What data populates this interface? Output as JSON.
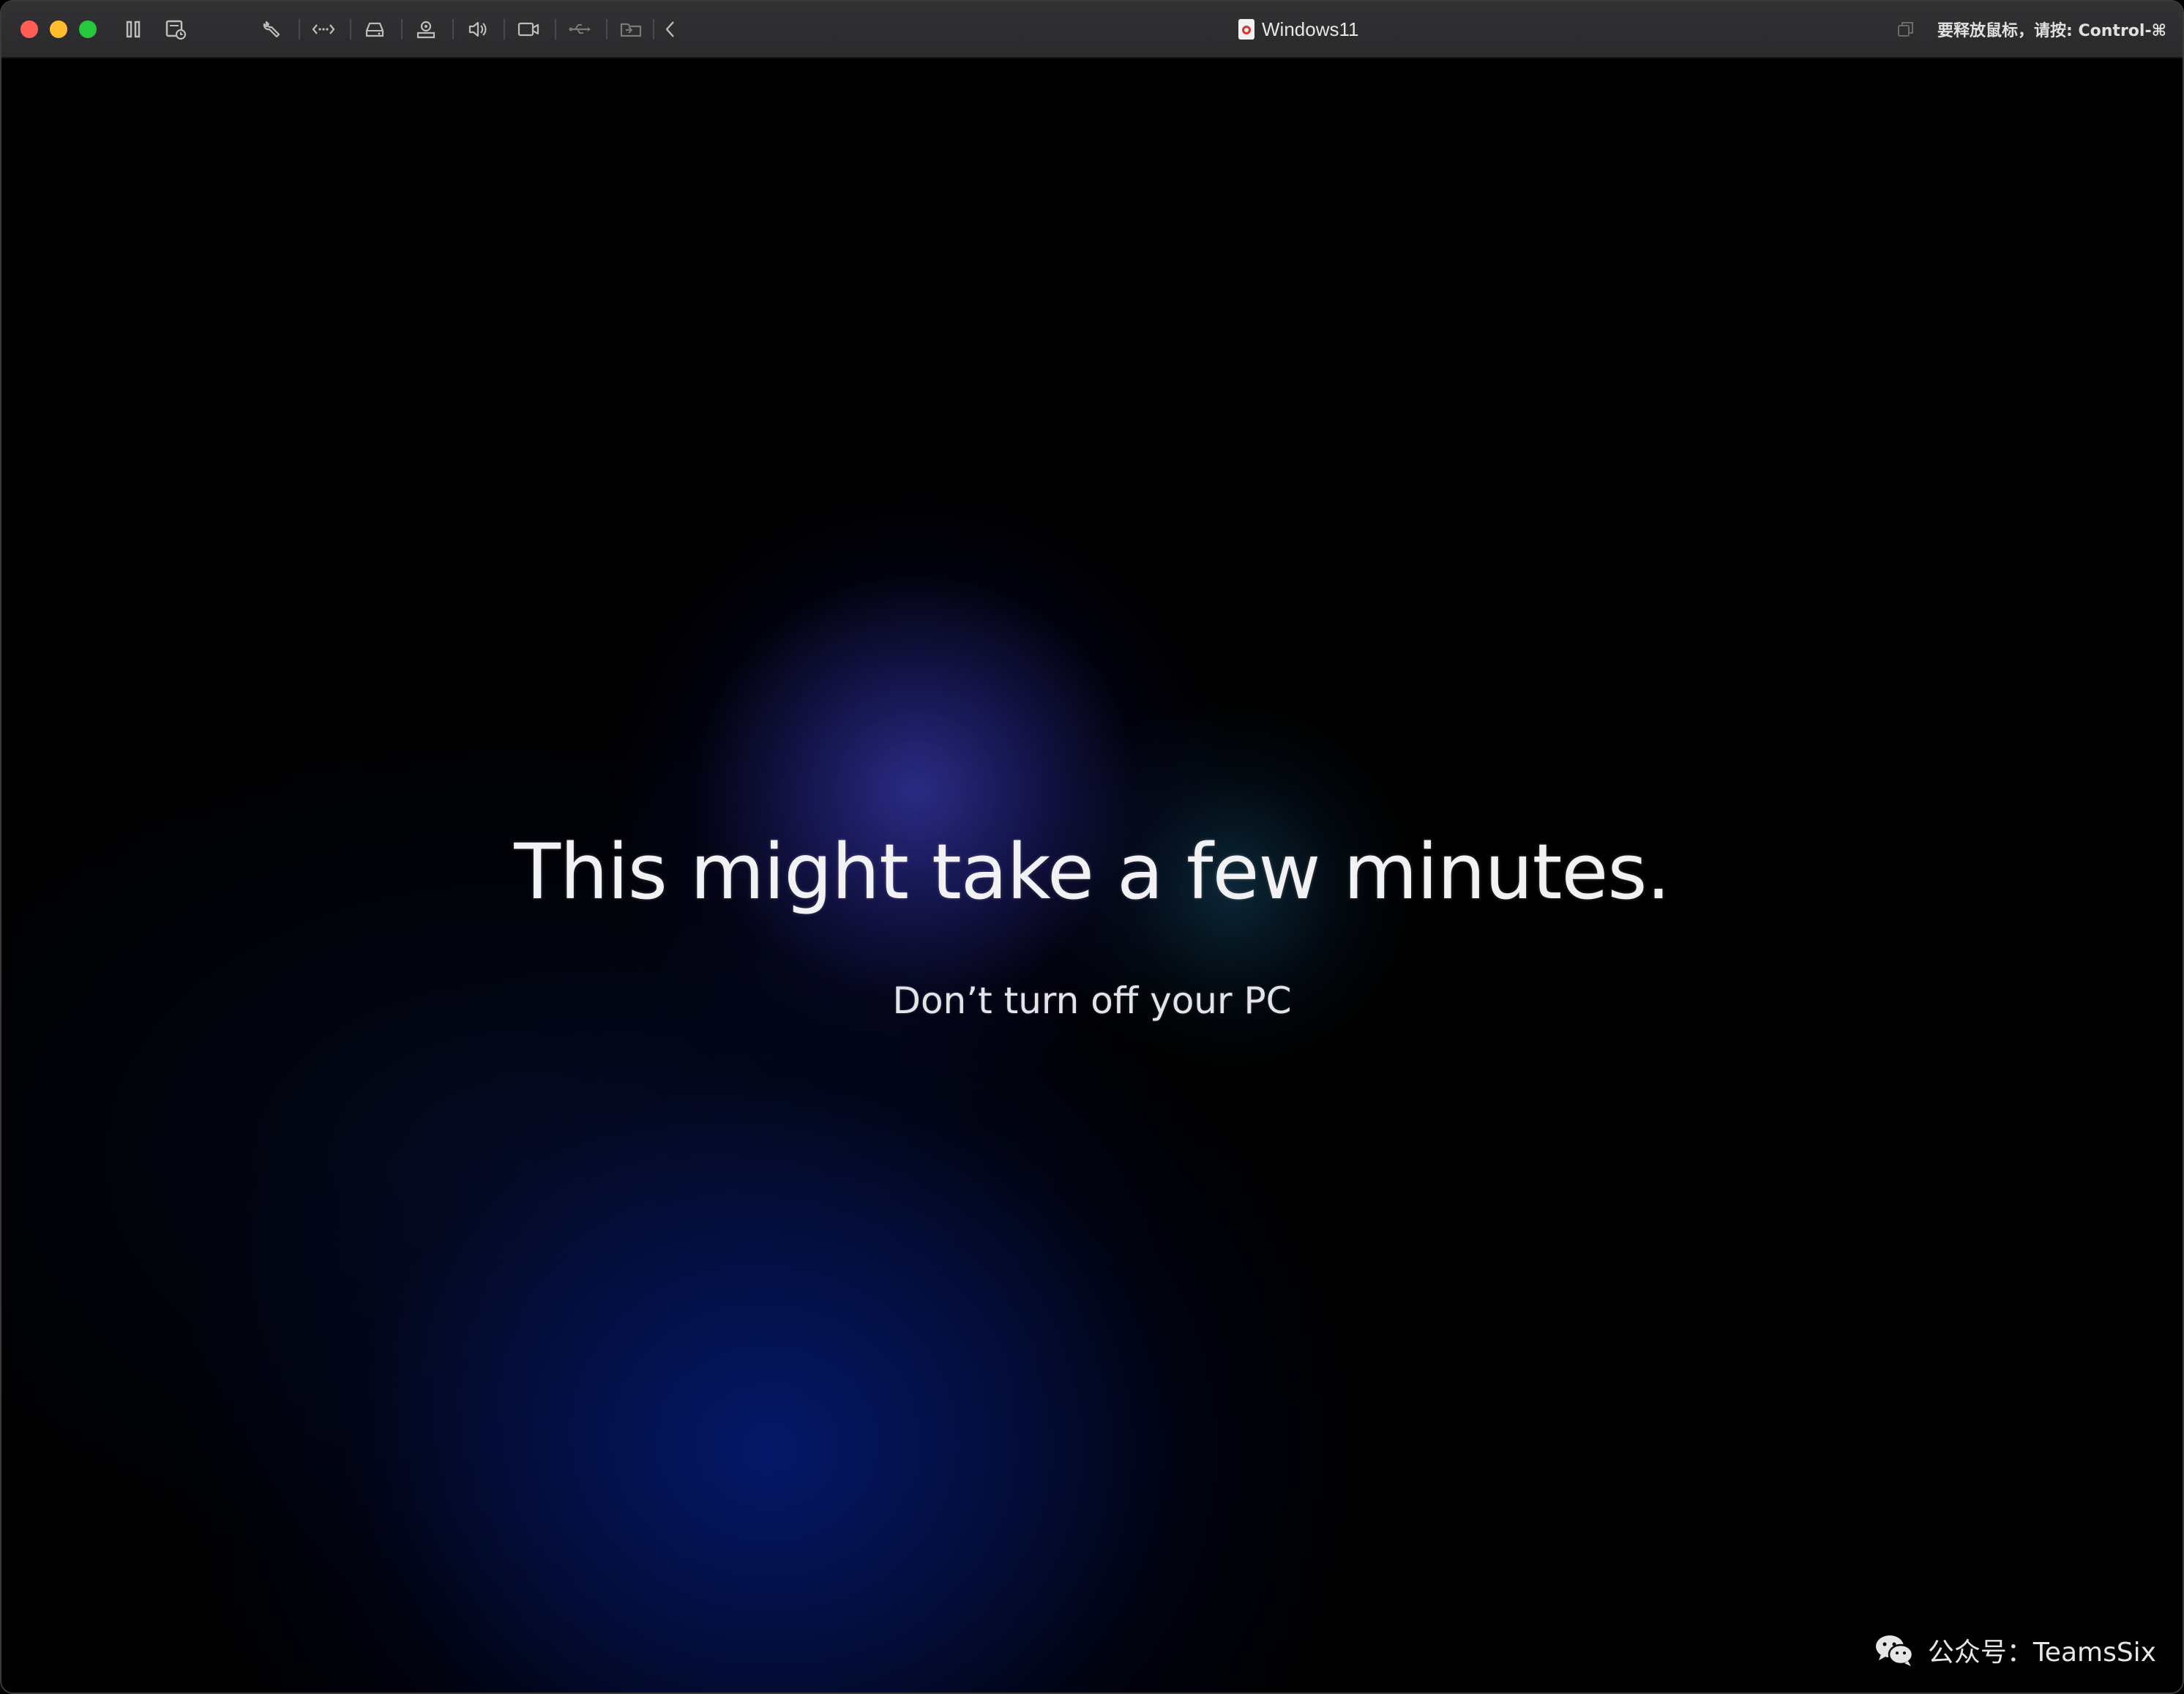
{
  "window": {
    "title": "Windows11",
    "release_hint": "要释放鼠标，请按: Control-⌘"
  },
  "toolbar": {
    "icons": [
      "pause-icon",
      "snapshot-icon",
      "wrench-icon",
      "network-icon",
      "hard-disk-icon",
      "printer-icon",
      "sound-icon",
      "camera-icon",
      "usb-icon",
      "shared-folder-icon",
      "chevron-left-icon"
    ]
  },
  "screen": {
    "headline": "This might take a few minutes.",
    "subtext": "Don’t turn off your PC"
  },
  "watermark": {
    "text": "公众号：TeamsSix"
  },
  "colors": {
    "close": "#ff5f57",
    "minimize": "#febc2e",
    "maximize": "#28c840",
    "background": "#000000",
    "glow_blue": "#1c1c6e"
  }
}
